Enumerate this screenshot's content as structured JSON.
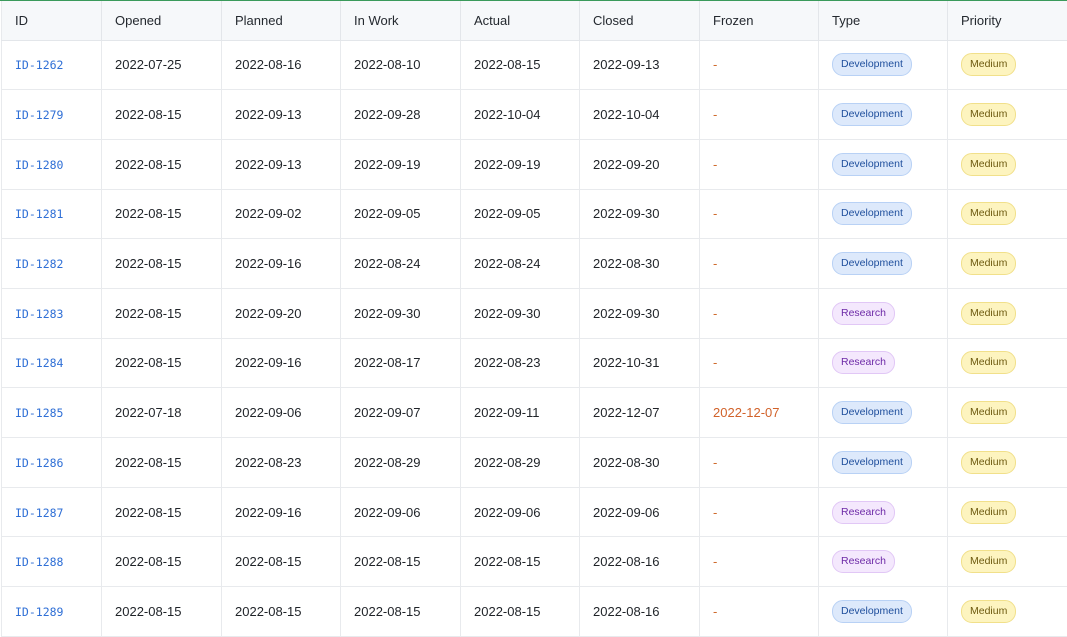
{
  "columns": [
    "ID",
    "Opened",
    "Planned",
    "In Work",
    "Actual",
    "Closed",
    "Frozen",
    "Type",
    "Priority"
  ],
  "rows": [
    {
      "id": "ID-1262",
      "opened": "2022-07-25",
      "planned": "2022-08-16",
      "in_work": "2022-08-10",
      "actual": "2022-08-15",
      "closed": "2022-09-13",
      "frozen": "-",
      "type": "Development",
      "priority": "Medium"
    },
    {
      "id": "ID-1279",
      "opened": "2022-08-15",
      "planned": "2022-09-13",
      "in_work": "2022-09-28",
      "actual": "2022-10-04",
      "closed": "2022-10-04",
      "frozen": "-",
      "type": "Development",
      "priority": "Medium"
    },
    {
      "id": "ID-1280",
      "opened": "2022-08-15",
      "planned": "2022-09-13",
      "in_work": "2022-09-19",
      "actual": "2022-09-19",
      "closed": "2022-09-20",
      "frozen": "-",
      "type": "Development",
      "priority": "Medium"
    },
    {
      "id": "ID-1281",
      "opened": "2022-08-15",
      "planned": "2022-09-02",
      "in_work": "2022-09-05",
      "actual": "2022-09-05",
      "closed": "2022-09-30",
      "frozen": "-",
      "type": "Development",
      "priority": "Medium"
    },
    {
      "id": "ID-1282",
      "opened": "2022-08-15",
      "planned": "2022-09-16",
      "in_work": "2022-08-24",
      "actual": "2022-08-24",
      "closed": "2022-08-30",
      "frozen": "-",
      "type": "Development",
      "priority": "Medium"
    },
    {
      "id": "ID-1283",
      "opened": "2022-08-15",
      "planned": "2022-09-20",
      "in_work": "2022-09-30",
      "actual": "2022-09-30",
      "closed": "2022-09-30",
      "frozen": "-",
      "type": "Research",
      "priority": "Medium"
    },
    {
      "id": "ID-1284",
      "opened": "2022-08-15",
      "planned": "2022-09-16",
      "in_work": "2022-08-17",
      "actual": "2022-08-23",
      "closed": "2022-10-31",
      "frozen": "-",
      "type": "Research",
      "priority": "Medium"
    },
    {
      "id": "ID-1285",
      "opened": "2022-07-18",
      "planned": "2022-09-06",
      "in_work": "2022-09-07",
      "actual": "2022-09-11",
      "closed": "2022-12-07",
      "frozen": "2022-12-07",
      "type": "Development",
      "priority": "Medium"
    },
    {
      "id": "ID-1286",
      "opened": "2022-08-15",
      "planned": "2022-08-23",
      "in_work": "2022-08-29",
      "actual": "2022-08-29",
      "closed": "2022-08-30",
      "frozen": "-",
      "type": "Development",
      "priority": "Medium"
    },
    {
      "id": "ID-1287",
      "opened": "2022-08-15",
      "planned": "2022-09-16",
      "in_work": "2022-09-06",
      "actual": "2022-09-06",
      "closed": "2022-09-06",
      "frozen": "-",
      "type": "Research",
      "priority": "Medium"
    },
    {
      "id": "ID-1288",
      "opened": "2022-08-15",
      "planned": "2022-08-15",
      "in_work": "2022-08-15",
      "actual": "2022-08-15",
      "closed": "2022-08-16",
      "frozen": "-",
      "type": "Research",
      "priority": "Medium"
    },
    {
      "id": "ID-1289",
      "opened": "2022-08-15",
      "planned": "2022-08-15",
      "in_work": "2022-08-15",
      "actual": "2022-08-15",
      "closed": "2022-08-16",
      "frozen": "-",
      "type": "Development",
      "priority": "Medium"
    }
  ]
}
